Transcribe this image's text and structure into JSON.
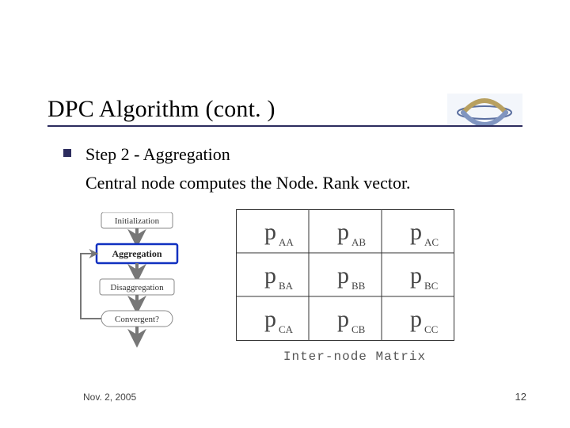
{
  "title": "DPC Algorithm (cont. )",
  "bullet": {
    "step_line": "Step 2 - Aggregation",
    "detail_line": "Central node computes the Node. Rank vector."
  },
  "flowchart": {
    "boxes": [
      "Initialization",
      "Aggregation",
      "Disaggregation",
      "Convergent?"
    ],
    "highlighted_index": 1
  },
  "matrix": {
    "caption": "Inter-node Matrix",
    "base_symbol": "p",
    "rows": [
      [
        "AA",
        "AB",
        "AC"
      ],
      [
        "BA",
        "BB",
        "BC"
      ],
      [
        "CA",
        "CB",
        "CC"
      ]
    ]
  },
  "footer": {
    "date": "Nov. 2, 2005",
    "page": "12"
  }
}
